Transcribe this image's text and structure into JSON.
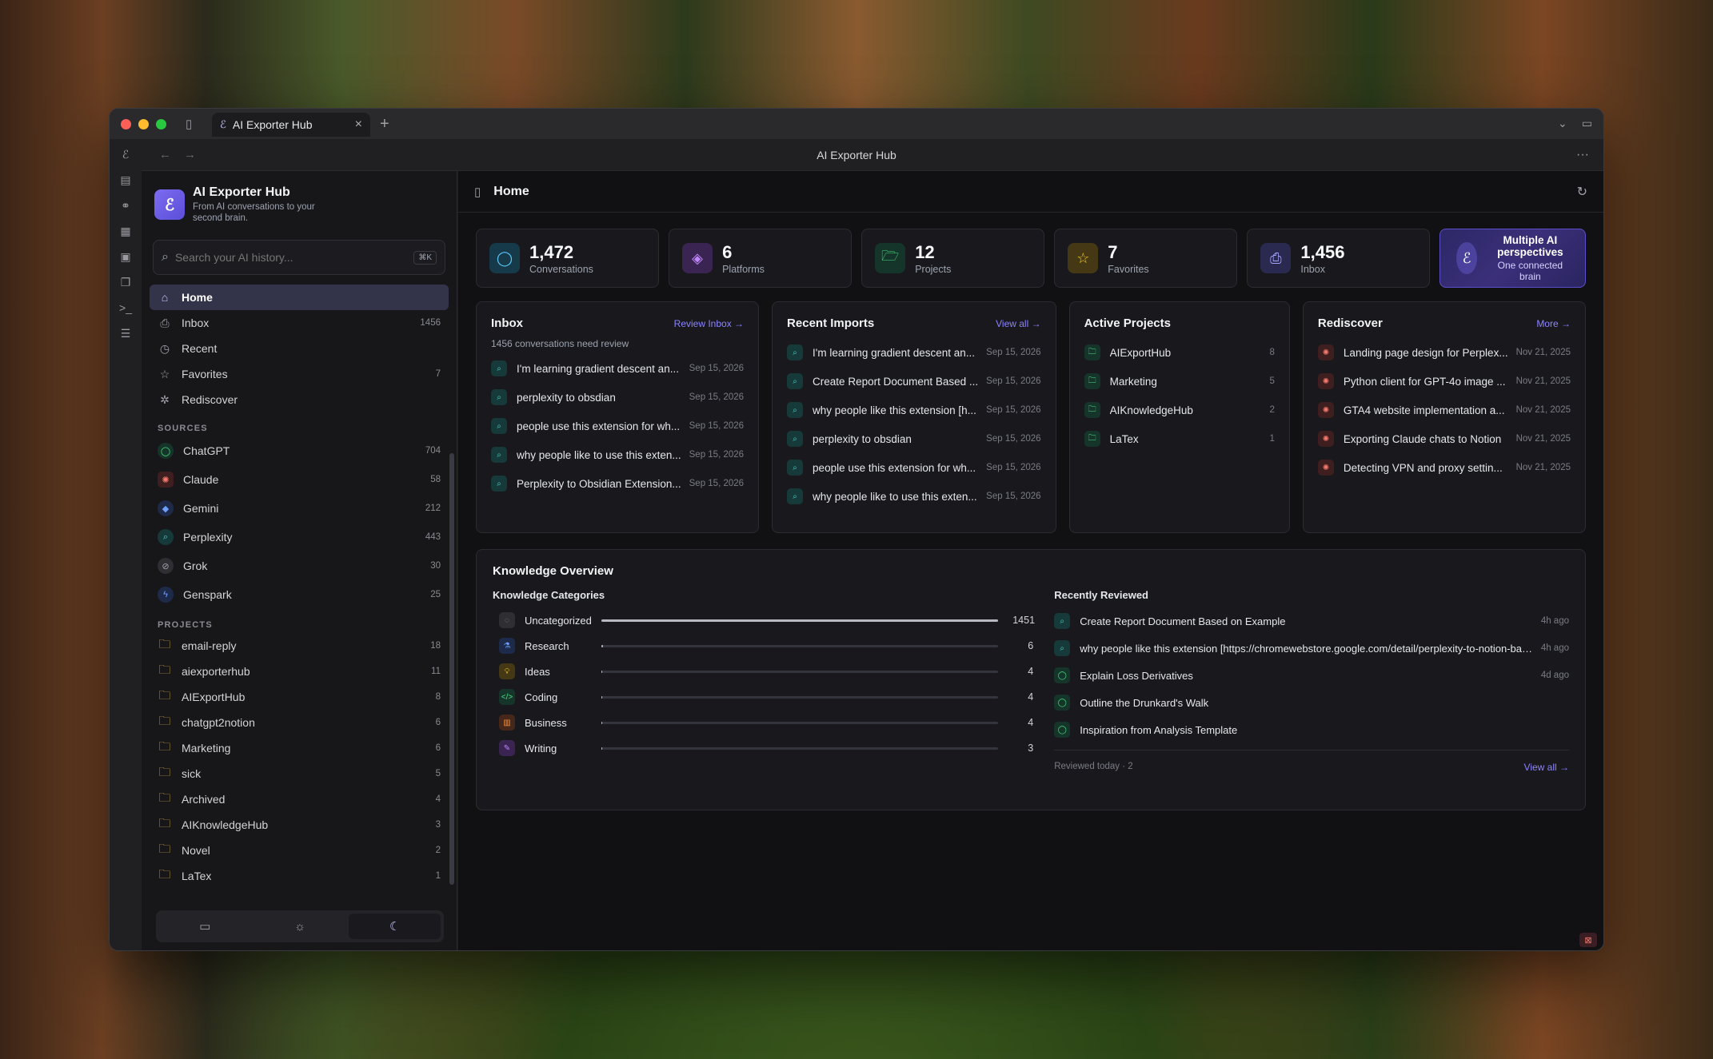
{
  "browser": {
    "tab_title": "AI Exporter Hub",
    "address_title": "AI Exporter Hub",
    "traffic_lights": [
      "#ff5f57",
      "#febc2e",
      "#28c840"
    ]
  },
  "app": {
    "name": "AI Exporter Hub",
    "tagline": "From AI conversations to your second brain.",
    "search_placeholder": "Search your AI history...",
    "search_shortcut": "⌘K",
    "accent": "#7c6cf0"
  },
  "sidebar": {
    "nav": [
      {
        "label": "Home",
        "count": ""
      },
      {
        "label": "Inbox",
        "count": "1456"
      },
      {
        "label": "Recent",
        "count": ""
      },
      {
        "label": "Favorites",
        "count": "7"
      },
      {
        "label": "Rediscover",
        "count": ""
      }
    ],
    "sources_heading": "SOURCES",
    "sources": [
      {
        "label": "ChatGPT",
        "count": "704"
      },
      {
        "label": "Claude",
        "count": "58"
      },
      {
        "label": "Gemini",
        "count": "212"
      },
      {
        "label": "Perplexity",
        "count": "443"
      },
      {
        "label": "Grok",
        "count": "30"
      },
      {
        "label": "Genspark",
        "count": "25"
      }
    ],
    "projects_heading": "PROJECTS",
    "projects": [
      {
        "label": "email-reply",
        "count": "18"
      },
      {
        "label": "aiexporterhub",
        "count": "11"
      },
      {
        "label": "AIExportHub",
        "count": "8"
      },
      {
        "label": "chatgpt2notion",
        "count": "6"
      },
      {
        "label": "Marketing",
        "count": "6"
      },
      {
        "label": "sick",
        "count": "5"
      },
      {
        "label": "Archived",
        "count": "4"
      },
      {
        "label": "AIKnowledgeHub",
        "count": "3"
      },
      {
        "label": "Novel",
        "count": "2"
      },
      {
        "label": "LaTex",
        "count": "1"
      }
    ]
  },
  "header": {
    "title": "Home"
  },
  "stats": [
    {
      "value": "1,472",
      "label": "Conversations"
    },
    {
      "value": "6",
      "label": "Platforms"
    },
    {
      "value": "12",
      "label": "Projects"
    },
    {
      "value": "7",
      "label": "Favorites"
    },
    {
      "value": "1,456",
      "label": "Inbox"
    }
  ],
  "promo": {
    "title": "Multiple AI perspectives",
    "subtitle": "One connected brain"
  },
  "inbox": {
    "title": "Inbox",
    "link": "Review Inbox →",
    "subtitle": "1456 conversations need review",
    "items": [
      {
        "title": "I'm learning gradient descent an...",
        "date": "Sep 15, 2026"
      },
      {
        "title": "perplexity to obsdian",
        "date": "Sep 15, 2026"
      },
      {
        "title": "people use this extension for wh...",
        "date": "Sep 15, 2026"
      },
      {
        "title": "why people like to use this exten...",
        "date": "Sep 15, 2026"
      },
      {
        "title": "Perplexity to Obsidian Extension...",
        "date": "Sep 15, 2026"
      }
    ]
  },
  "recent_imports": {
    "title": "Recent Imports",
    "link": "View all →",
    "items": [
      {
        "title": "I'm learning gradient descent an...",
        "date": "Sep 15, 2026"
      },
      {
        "title": "Create Report Document Based ...",
        "date": "Sep 15, 2026"
      },
      {
        "title": "why people like this extension [h...",
        "date": "Sep 15, 2026"
      },
      {
        "title": "perplexity to obsdian",
        "date": "Sep 15, 2026"
      },
      {
        "title": "people use this extension for wh...",
        "date": "Sep 15, 2026"
      },
      {
        "title": "why people like to use this exten...",
        "date": "Sep 15, 2026"
      }
    ]
  },
  "active_projects": {
    "title": "Active Projects",
    "items": [
      {
        "title": "AIExportHub",
        "count": "8"
      },
      {
        "title": "Marketing",
        "count": "5"
      },
      {
        "title": "AIKnowledgeHub",
        "count": "2"
      },
      {
        "title": "LaTex",
        "count": "1"
      }
    ]
  },
  "rediscover": {
    "title": "Rediscover",
    "link": "More →",
    "items": [
      {
        "title": "Landing page design for Perplex...",
        "date": "Nov 21, 2025"
      },
      {
        "title": "Python client for GPT-4o image ...",
        "date": "Nov 21, 2025"
      },
      {
        "title": "GTA4 website implementation a...",
        "date": "Nov 21, 2025"
      },
      {
        "title": "Exporting Claude chats to Notion",
        "date": "Nov 21, 2025"
      },
      {
        "title": "Detecting VPN and proxy settin...",
        "date": "Nov 21, 2025"
      }
    ]
  },
  "knowledge": {
    "title": "Knowledge Overview",
    "categories_title": "Knowledge Categories",
    "categories": [
      {
        "label": "Uncategorized",
        "count": "1451",
        "fraction": 1.0
      },
      {
        "label": "Research",
        "count": "6",
        "fraction": 0.004
      },
      {
        "label": "Ideas",
        "count": "4",
        "fraction": 0.003
      },
      {
        "label": "Coding",
        "count": "4",
        "fraction": 0.003
      },
      {
        "label": "Business",
        "count": "4",
        "fraction": 0.003
      },
      {
        "label": "Writing",
        "count": "3",
        "fraction": 0.002
      }
    ],
    "reviewed_title": "Recently Reviewed",
    "reviewed": [
      {
        "title": "Create Report Document Based on Example",
        "time": "4h ago"
      },
      {
        "title": "why people like this extension [https://chromewebstore.google.com/detail/perplexity-to-notion-batc/g...",
        "time": "4h ago"
      },
      {
        "title": "Explain Loss Derivatives",
        "time": "4d ago"
      },
      {
        "title": "Outline the Drunkard's Walk",
        "time": ""
      },
      {
        "title": "Inspiration from Analysis Template",
        "time": ""
      }
    ],
    "reviewed_footer": "Reviewed today · 2",
    "reviewed_link": "View all →"
  }
}
